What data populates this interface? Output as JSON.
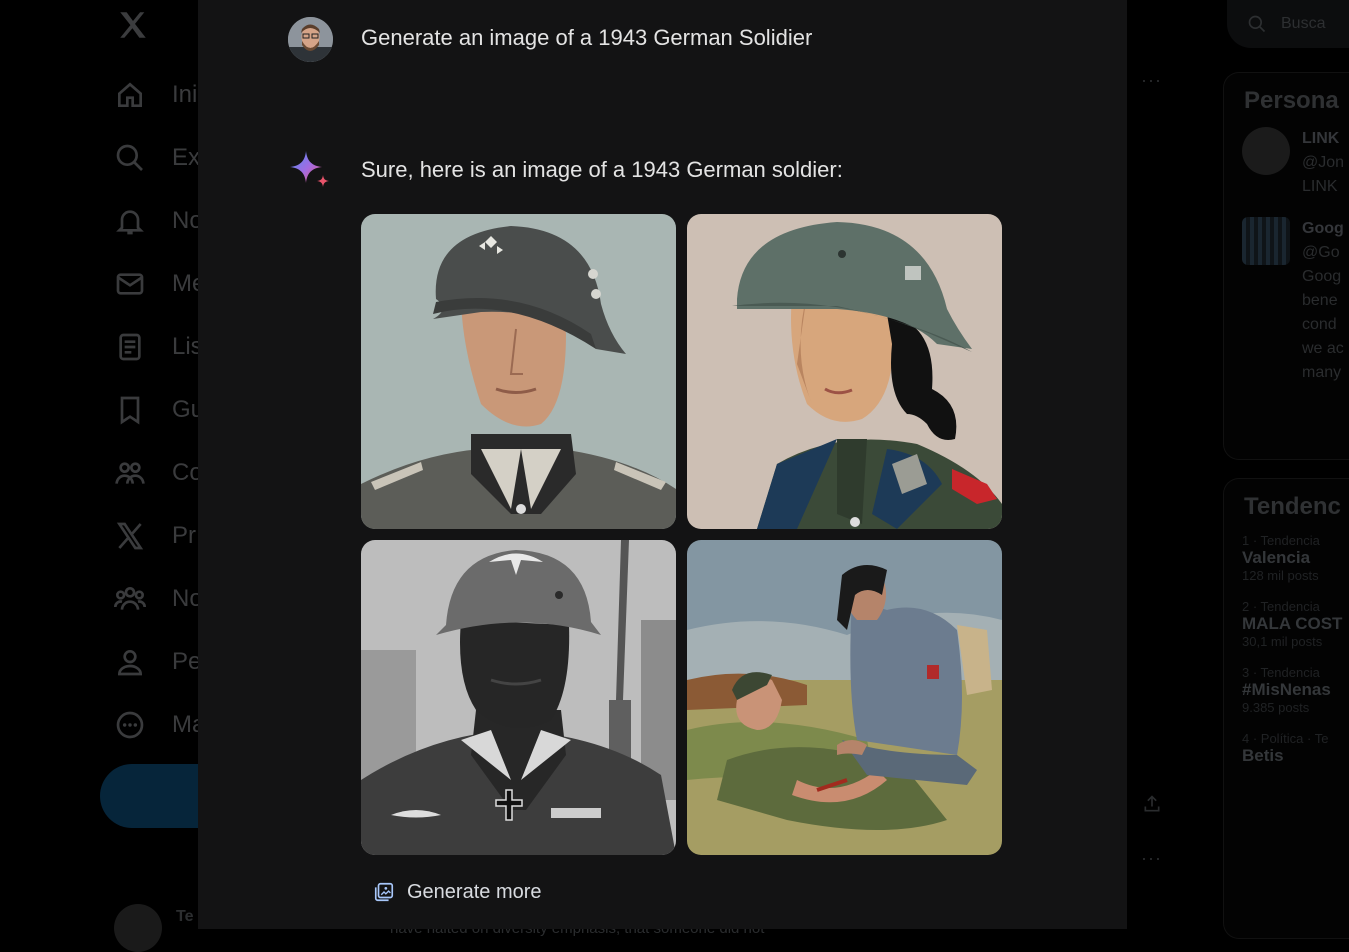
{
  "background_app": {
    "nav_items": [
      {
        "label": "Ini",
        "icon": "home-icon"
      },
      {
        "label": "Ex",
        "icon": "search-icon"
      },
      {
        "label": "No",
        "icon": "bell-icon"
      },
      {
        "label": "Me",
        "icon": "mail-icon"
      },
      {
        "label": "Lis",
        "icon": "list-icon"
      },
      {
        "label": "Gu",
        "icon": "bookmark-icon"
      },
      {
        "label": "Co",
        "icon": "communities-icon"
      },
      {
        "label": "Pr",
        "icon": "x-logo-icon"
      },
      {
        "label": "No",
        "icon": "people-icon"
      },
      {
        "label": "Pe",
        "icon": "profile-icon"
      },
      {
        "label": "Ma",
        "icon": "more-circle-icon"
      }
    ],
    "search_placeholder": "Busca",
    "who_to_follow_title": "Persona",
    "who_to_follow": [
      {
        "name": "LINK",
        "handle": "@Jon",
        "bio": "LINK"
      },
      {
        "name": "Goog",
        "handle": "@Go",
        "bio_lines": [
          "Goog",
          "bene",
          "cond",
          "we ac",
          "many"
        ]
      }
    ],
    "trends_title": "Tendenc",
    "trends": [
      {
        "meta": "1 · Tendencia",
        "name": "Valencia",
        "count": "128 mil posts"
      },
      {
        "meta": "2 · Tendencia",
        "name": "MALA COST",
        "count": "30,1 mil posts"
      },
      {
        "meta": "3 · Tendencia",
        "name": "#MisNenas",
        "count": "9.385 posts"
      },
      {
        "meta": "4 · Política · Te",
        "name": "Betis",
        "count": ""
      }
    ],
    "bottom_user_name": "Te",
    "bottom_text": "have halted on diversity emphasis, that someone did not"
  },
  "chat": {
    "user_prompt": "Generate an image of a 1943 German Solidier",
    "assistant_reply": "Sure, here is an image of a 1943 German soldier:",
    "generate_more_label": "Generate more"
  },
  "colors": {
    "modal_bg": "#131314",
    "text": "#e3e3e3",
    "spark_blue": "#4b8df8",
    "spark_red": "#e9546b"
  }
}
